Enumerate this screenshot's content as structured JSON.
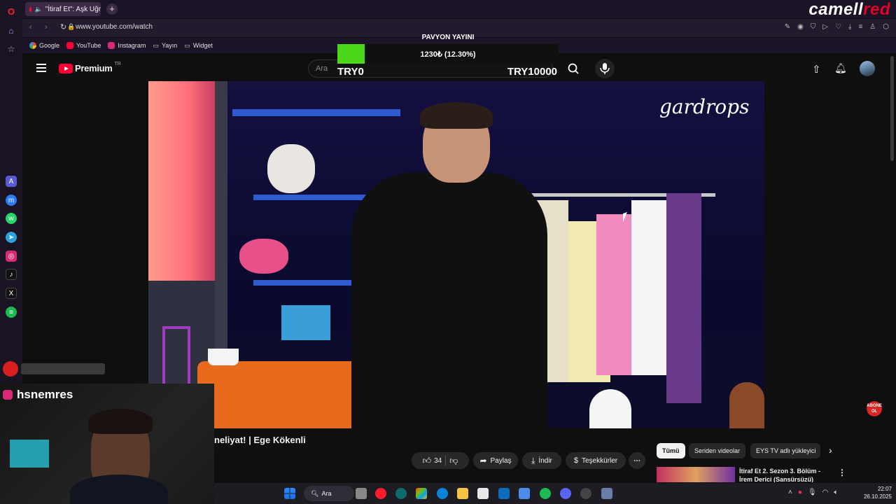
{
  "browser": {
    "tab_title": "\"İtiraf Et\": Aşk Uğr",
    "url": "www.youtube.com/watch",
    "bookmarks": [
      "Google",
      "YouTube",
      "Instagram",
      "Yayın",
      "Widget"
    ]
  },
  "brand_watermark": "camellred",
  "youtube": {
    "logo_text": "Premium",
    "logo_region": "TR",
    "search_placeholder": "Ara",
    "video_watermark": "gardrops",
    "video_title": "neliyat! | Ege Kökenli",
    "actions": {
      "like_count": "34",
      "share": "Paylaş",
      "download": "İndir",
      "thanks": "Teşekkürler"
    },
    "chips": [
      "Tümü",
      "Seriden videolar",
      "EYS TV adlı yükleyici"
    ],
    "related_title_line1": "İtiraf Et 2. Sezon 3. Bölüm -",
    "related_title_line2": "İrem Derici (Sansürsüzü)",
    "subscribe_badge_1": "ABONE",
    "subscribe_badge_2": "OL"
  },
  "donation": {
    "title": "PAVYON YAYINI",
    "status": "1230₺ (12.30%)",
    "progress": 0.123,
    "min_label": "TRY0",
    "max_label": "TRY10000"
  },
  "streamer": {
    "instagram_handle": "hsnemres"
  },
  "taskbar": {
    "search_label": "Ara",
    "time": "22:07",
    "date": "26.10.2025"
  },
  "colors": {
    "youtube_red": "#ff0033",
    "progress_green": "#4bd81a",
    "brand_red": "#e0002a"
  }
}
